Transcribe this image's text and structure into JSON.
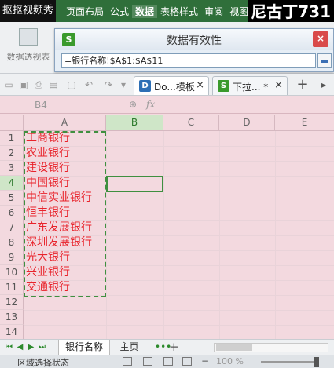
{
  "watermark": {
    "left": "抠抠视频秀",
    "right": "尼古丁731"
  },
  "menu": {
    "items": [
      "页面布局",
      "公式",
      "数据",
      "表格样式",
      "审阅",
      "视图"
    ],
    "active_index": 2
  },
  "ribbon": {
    "pivot_label": "数据透视表"
  },
  "dialog": {
    "title": "数据有效性",
    "app_icon": "S",
    "close_icon": "×",
    "source_value": "=银行名称!$A$1:$A$11"
  },
  "toolbar": {
    "icons": [
      "new-icon",
      "save-icon",
      "print-icon",
      "preview-icon",
      "paste-icon",
      "undo-icon",
      "redo-icon",
      "more-icon"
    ],
    "tabs": [
      {
        "icon": "D",
        "icon_color": "#2d6fb5",
        "label": "Do...模板",
        "close": "×"
      },
      {
        "icon": "S",
        "icon_color": "#3a9a2c",
        "label": "下拉... *",
        "close": "×"
      }
    ],
    "add": "+",
    "more": "▸"
  },
  "formula_bar": {
    "name_box": "B4",
    "zoom_icon": "⊕",
    "fx_label": "fx"
  },
  "grid": {
    "columns": [
      "A",
      "B",
      "C",
      "D",
      "E"
    ],
    "selected_column": "B",
    "rows": [
      "1",
      "2",
      "3",
      "4",
      "5",
      "6",
      "7",
      "8",
      "9",
      "10",
      "11",
      "12",
      "13",
      "14"
    ],
    "selected_row": "4",
    "column_a_values": [
      "工商银行",
      "农业银行",
      "建设银行",
      "中国银行",
      "中信实业银行",
      "恒丰银行",
      "广东发展银行",
      "深圳发展银行",
      "光大银行",
      "兴业银行",
      "交通银行"
    ],
    "text_color": "#e8232b",
    "accent_color": "#3f8f3f"
  },
  "sheets": {
    "tabs": [
      "银行名称",
      "主页"
    ],
    "active_index": 0,
    "more": "•••",
    "add": "+"
  },
  "status": {
    "text": "区域选择状态",
    "zoom_minus": "−",
    "zoom_level": "100 %"
  }
}
